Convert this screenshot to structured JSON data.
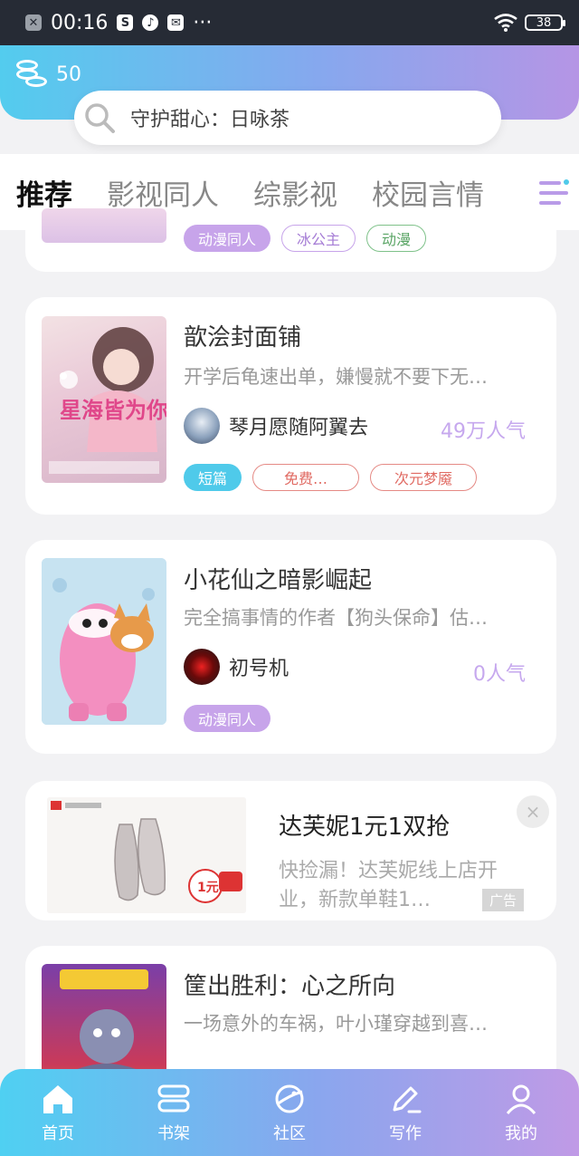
{
  "status_bar": {
    "time": "00:16",
    "battery": "38",
    "more": "···"
  },
  "header": {
    "coin_count": "50",
    "search_placeholder": "守护甜心：日咏茶"
  },
  "tabs": [
    {
      "label": "推荐",
      "active": true
    },
    {
      "label": "影视同人",
      "active": false
    },
    {
      "label": "综影视",
      "active": false
    },
    {
      "label": "校园言情",
      "active": false
    }
  ],
  "partial_card": {
    "tags": [
      "动漫同人",
      "冰公主",
      "动漫"
    ]
  },
  "books": [
    {
      "title": "歆浍封面铺",
      "description": "开学后龟速出单，嫌慢就不要下无…",
      "author": "琴月愿随阿翼去",
      "popularity": "49万人气",
      "cover_text": "星海皆为你",
      "tags": [
        "短篇",
        "免费…",
        "次元梦魇"
      ]
    },
    {
      "title": "小花仙之暗影崛起",
      "description": "完全搞事情的作者【狗头保命】估…",
      "author": "初号机",
      "popularity": "0人气",
      "tags": [
        "动漫同人"
      ]
    },
    {
      "title": "筐出胜利：心之所向",
      "description": "一场意外的车祸，叶小瑾穿越到喜…"
    }
  ],
  "ad": {
    "title": "达芙妮1元1双抢",
    "description": "快捡漏！达芙妮线上店开业，新款单鞋1…",
    "badge": "广告",
    "close": "×",
    "price": "1元"
  },
  "bottom_nav": [
    {
      "label": "首页",
      "icon": "home-icon"
    },
    {
      "label": "书架",
      "icon": "bookshelf-icon"
    },
    {
      "label": "社区",
      "icon": "planet-icon"
    },
    {
      "label": "写作",
      "icon": "pen-icon"
    },
    {
      "label": "我的",
      "icon": "user-icon"
    }
  ],
  "colors": {
    "accent_purple": "#c6a8ee",
    "accent_cyan": "#4fcaea",
    "nav_gradient_start": "#4fd0f2",
    "nav_gradient_end": "#c09ae6"
  }
}
